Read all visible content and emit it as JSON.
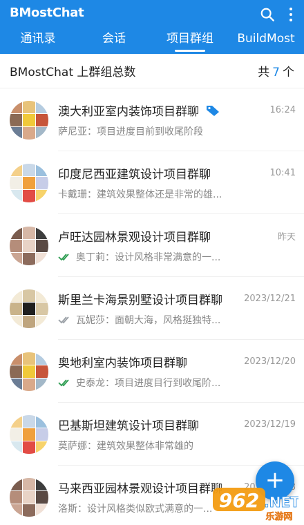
{
  "app": {
    "title": "BMostChat"
  },
  "tabs": [
    {
      "label": "通讯录",
      "active": false
    },
    {
      "label": "会话",
      "active": false
    },
    {
      "label": "项目群组",
      "active": true
    },
    {
      "label": "BuildMost",
      "active": false
    }
  ],
  "summary": {
    "label": "BMostChat 上群组总数",
    "prefix": "共",
    "count": "7",
    "suffix": "个"
  },
  "groups": [
    {
      "name": "澳大利亚室内装饰项目群聊",
      "time": "16:24",
      "preview": "萨尼亚：项目进度目前到收尾阶段",
      "tag": true,
      "read": false,
      "read_color": "",
      "colors": [
        "#c98f6b",
        "#e8c37a",
        "#b5cce0",
        "#8b6a55",
        "#f0c93a",
        "#c7553a",
        "#6b7d95",
        "#d9a98a",
        "#a3b8c8"
      ]
    },
    {
      "name": "印度尼西亚建筑设计项目群聊",
      "time": "10:41",
      "preview": "卡戴珊：建筑效果整体还是非常的雄...",
      "tag": false,
      "read": false,
      "read_color": "",
      "colors": [
        "#f4d08a",
        "#c9d8e8",
        "#9bc0de",
        "#f2efe6",
        "#f0a03c",
        "#c7cde8",
        "#d8e8ef",
        "#e24c45",
        "#f7d36b"
      ]
    },
    {
      "name": "卢旺达园林景观设计项目群聊",
      "time": "昨天",
      "preview": "奥丁莉：设计风格非常满意的一...",
      "tag": false,
      "read": true,
      "read_color": "#2e9d52",
      "colors": [
        "#7a5c4e",
        "#d6b7a6",
        "#3d3d3d",
        "#b58d7a",
        "#e8d3c6",
        "#5a4a44",
        "#caa593",
        "#8c6b5c",
        "#f0e0d6"
      ]
    },
    {
      "name": "斯里兰卡海景别墅设计项目群聊",
      "time": "2023/12/21",
      "preview": "瓦妮莎：面朝大海，风格挺独特...",
      "tag": false,
      "read": true,
      "read_color": "#9aa0a6",
      "colors": [
        "#f3ead6",
        "#d8c7a4",
        "#f3ead6",
        "#c9b38a",
        "#1f1f1f",
        "#d8c7a4",
        "#f3ead6",
        "#bfa57e",
        "#f3ead6"
      ]
    },
    {
      "name": "奥地利室内装饰项目群聊",
      "time": "2023/12/20",
      "preview": "史泰龙：项目进度目行到收尾阶...",
      "tag": false,
      "read": true,
      "read_color": "#2e9d52",
      "colors": [
        "#c98f6b",
        "#e8c37a",
        "#b5cce0",
        "#8b6a55",
        "#f0c93a",
        "#c7553a",
        "#6b7d95",
        "#d9a98a",
        "#a3b8c8"
      ]
    },
    {
      "name": "巴基斯坦建筑设计项目群聊",
      "time": "2023/12/19",
      "preview": "莫萨娜：建筑效果整体非常雄的",
      "tag": false,
      "read": false,
      "read_color": "",
      "colors": [
        "#f4d08a",
        "#c9d8e8",
        "#9bc0de",
        "#f2efe6",
        "#f0a03c",
        "#c7cde8",
        "#d8e8ef",
        "#e24c45",
        "#f7d36b"
      ]
    },
    {
      "name": "马来西亚园林景观设计项目群聊",
      "time": "2023/12/18",
      "preview": "洛斯：设计风格类似欧式满意的一...",
      "tag": false,
      "read": false,
      "read_color": "",
      "colors": [
        "#7a5c4e",
        "#d6b7a6",
        "#3d3d3d",
        "#b58d7a",
        "#e8d3c6",
        "#5a4a44",
        "#caa593",
        "#8c6b5c",
        "#f0e0d6"
      ]
    }
  ],
  "fab": {
    "label": "+"
  },
  "watermark": {
    "brand": "962",
    "suffix": ".NET",
    "site": "乐游网"
  }
}
